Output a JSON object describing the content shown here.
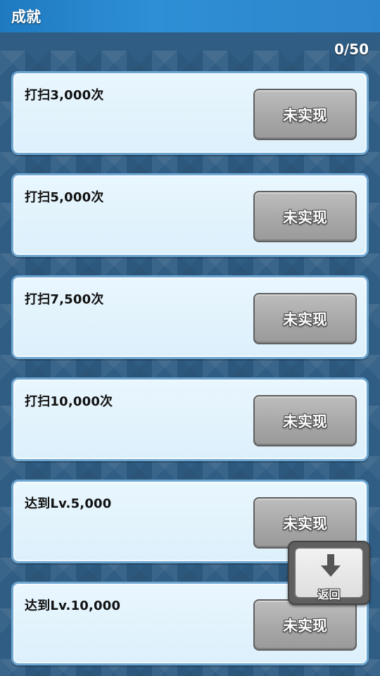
{
  "header": {
    "title": "成就"
  },
  "progress": {
    "text": "0/50"
  },
  "achievements": [
    {
      "label": "打扫3,000次",
      "status": "未实现"
    },
    {
      "label": "打扫5,000次",
      "status": "未实现"
    },
    {
      "label": "打扫7,500次",
      "status": "未实现"
    },
    {
      "label": "打扫10,000次",
      "status": "未实现"
    },
    {
      "label": "达到Lv.5,000",
      "status": "未实现"
    },
    {
      "label": "达到Lv.10,000",
      "status": "未实现"
    }
  ],
  "return_button": {
    "label": "返回",
    "icon": "down-arrow-icon"
  },
  "colors": {
    "header": "#2e8fd6",
    "background": "#2f5d84",
    "card": "#e3f3fd",
    "card_border": "#6da6d1",
    "button": "#a6a6a6"
  }
}
